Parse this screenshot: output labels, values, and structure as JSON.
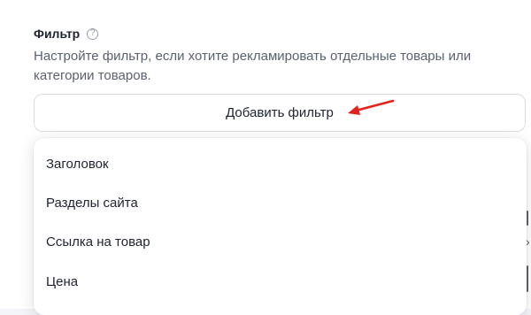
{
  "filter": {
    "title": "Фильтр",
    "help_icon_glyph": "?",
    "description": "Настройте фильтр, если хотите рекламировать отдельные товары или категории товаров.",
    "add_button_label": "Добавить фильтр",
    "arrow_color": "#e3221b"
  },
  "dropdown": {
    "items": [
      {
        "label": "Заголовок"
      },
      {
        "label": "Разделы сайта"
      },
      {
        "label": "Ссылка на товар"
      },
      {
        "label": "Цена"
      }
    ]
  },
  "background_edge": {
    "chevron_glyph": "›"
  }
}
